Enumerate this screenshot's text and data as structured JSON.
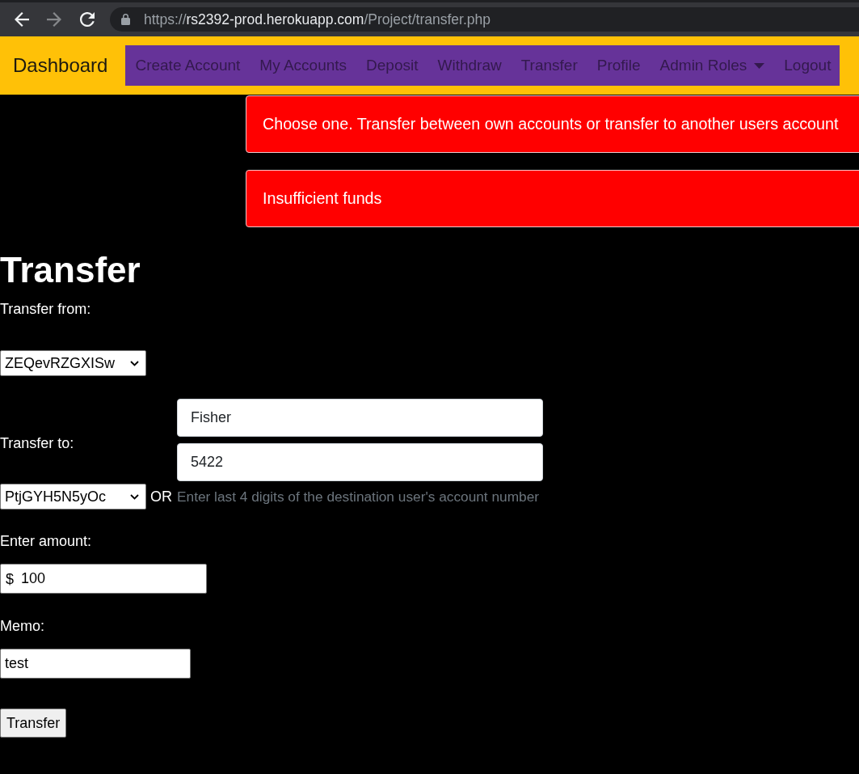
{
  "browser": {
    "back": {
      "disabled": false
    },
    "forward": {
      "disabled": true
    },
    "url": {
      "scheme": "https://",
      "host": "rs2392-prod.herokuapp.com",
      "path": "/Project/transfer.php"
    }
  },
  "navbar": {
    "brand": "Dashboard",
    "links": [
      {
        "label": "Create Account",
        "dropdown": false
      },
      {
        "label": "My Accounts",
        "dropdown": false
      },
      {
        "label": "Deposit",
        "dropdown": false
      },
      {
        "label": "Withdraw",
        "dropdown": false
      },
      {
        "label": "Transfer",
        "dropdown": false
      },
      {
        "label": "Profile",
        "dropdown": false
      },
      {
        "label": "Admin Roles",
        "dropdown": true
      },
      {
        "label": "Logout",
        "dropdown": false
      }
    ]
  },
  "alerts": [
    {
      "text": "Choose one. Transfer between own accounts or transfer to another users account"
    },
    {
      "text": "Insufficient funds"
    }
  ],
  "page": {
    "title": "Transfer"
  },
  "form": {
    "from_label": "Transfer from:",
    "from_account": "ZEQevRZGXISw",
    "to_label": "Transfer to:",
    "last_name": "Fisher",
    "account_digits": "5422",
    "to_account": "PtjGYH5N5yOc",
    "or_text": "OR",
    "digits_help": "Enter last 4 digits of the destination user's account number",
    "amount_label": "Enter amount:",
    "currency": "$",
    "amount": "100",
    "memo_label": "Memo:",
    "memo": "test",
    "submit": "Transfer"
  }
}
